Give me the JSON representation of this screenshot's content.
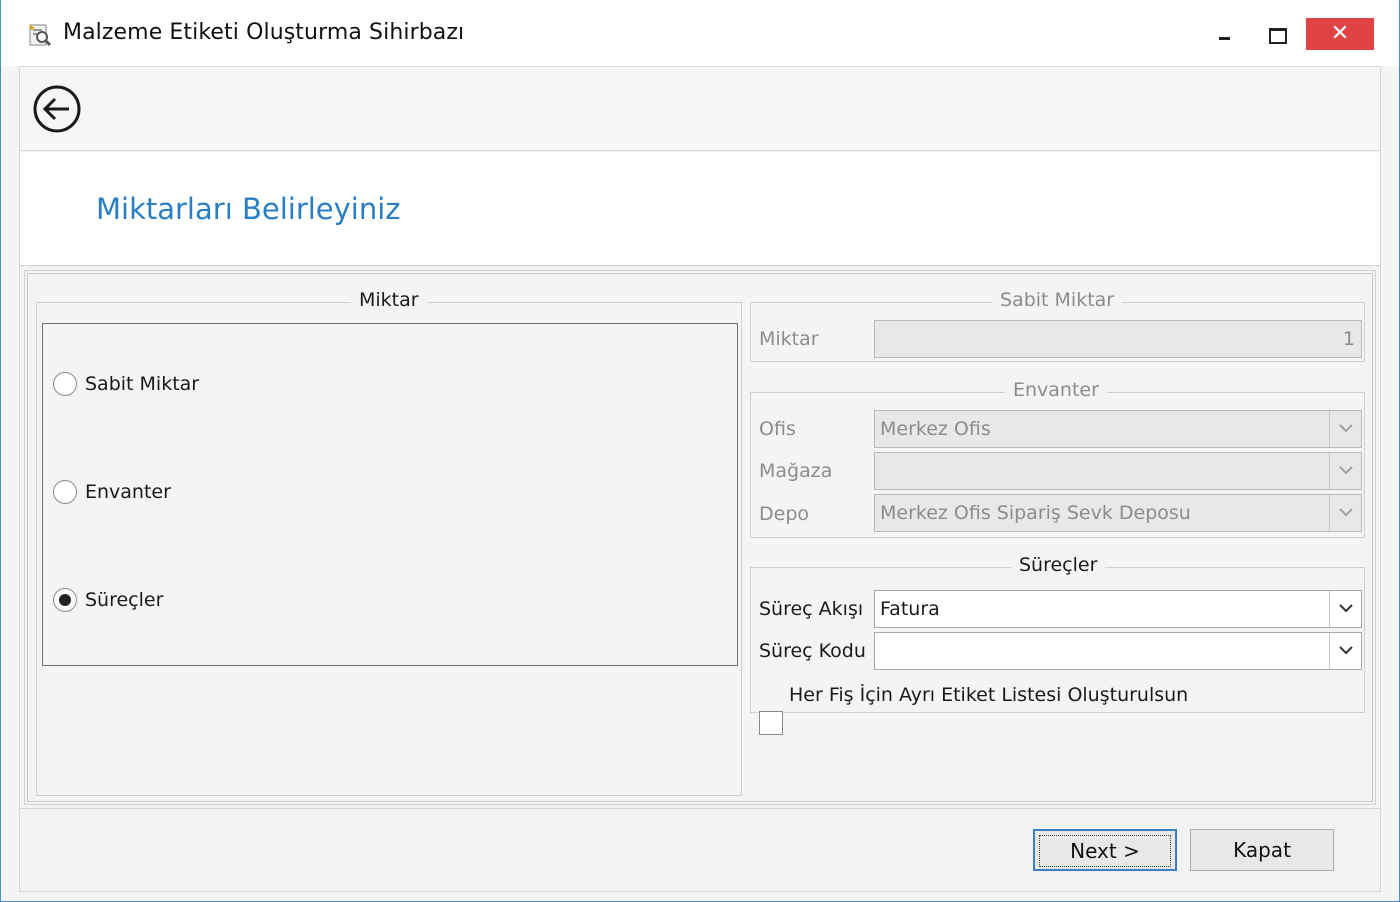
{
  "window": {
    "title": "Malzeme Etiketi Oluşturma Sihirbazı",
    "close_glyph": "✕"
  },
  "header": {
    "title": "Miktarları Belirleyiniz"
  },
  "miktar_group": {
    "title": "Miktar",
    "options": [
      {
        "label": "Sabit Miktar",
        "checked": false
      },
      {
        "label": "Envanter",
        "checked": false
      },
      {
        "label": "Süreçler",
        "checked": true
      }
    ]
  },
  "sabit_group": {
    "title": "Sabit Miktar",
    "miktar_label": "Miktar",
    "miktar_value": "1"
  },
  "envanter_group": {
    "title": "Envanter",
    "ofis_label": "Ofis",
    "ofis_value": "Merkez Ofis",
    "magaza_label": "Mağaza",
    "magaza_value": "",
    "depo_label": "Depo",
    "depo_value": "Merkez Ofis Sipariş Sevk Deposu"
  },
  "surecler_group": {
    "title": "Süreçler",
    "akis_label": "Süreç Akışı",
    "akis_value": "Fatura",
    "kod_label": "Süreç Kodu",
    "kod_value": "",
    "checkbox_label": "Her Fiş İçin Ayrı Etiket Listesi Oluşturulsun",
    "checkbox_checked": false
  },
  "footer": {
    "next_label": "Next >",
    "close_label": "Kapat"
  },
  "colors": {
    "title_accent": "#2a7fc4",
    "close_button": "#e04343"
  }
}
